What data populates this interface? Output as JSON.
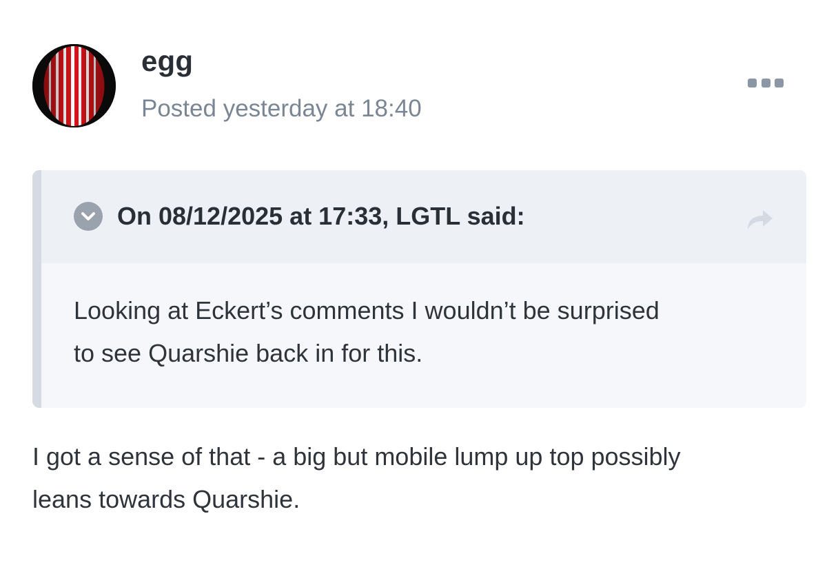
{
  "post": {
    "author": "egg",
    "posted": "Posted yesterday at 18:40",
    "more_icon": "ellipsis-icon",
    "avatar_colors": {
      "stripe_red": "#d8141a",
      "stripe_white": "#ffffff",
      "background": "#0a0a0a"
    }
  },
  "quote": {
    "toggle_icon": "chevron-down-icon",
    "title": "On 08/12/2025 at 17:33, LGTL said:",
    "goto_icon": "share-arrow-icon",
    "lines": [
      "Looking at Eckert’s comments I wouldn’t be surprised",
      "to see Quarshie back in for this."
    ]
  },
  "body": {
    "lines": [
      "I got a sense of that - a big but mobile lump up top possibly",
      "leans towards Quarshie."
    ]
  }
}
